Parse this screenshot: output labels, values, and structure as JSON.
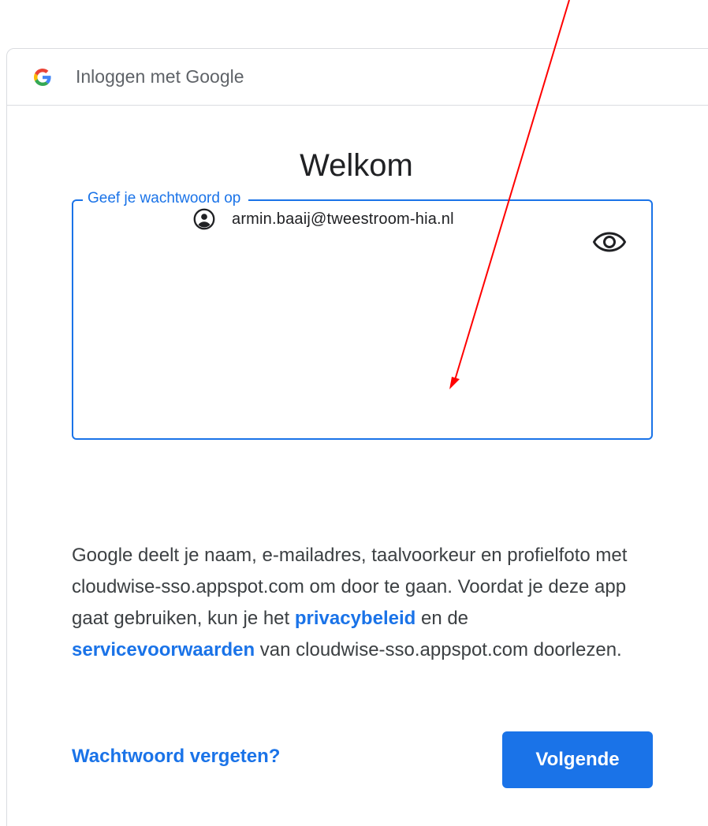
{
  "header": {
    "title": "Inloggen met Google",
    "logo_icon": "google-g-icon"
  },
  "main": {
    "title": "Welkom",
    "account": {
      "icon": "account-circle-icon",
      "email": "armin.baaij@tweestroom-hia.nl"
    },
    "password_field": {
      "label": "Geef je wachtwoord op",
      "value": "",
      "toggle_icon": "eye-icon"
    },
    "consent": {
      "part1": "Google deelt je naam, e-mailadres, taalvoorkeur en profielfoto met cloudwise-sso.appspot.com om door te gaan. Voordat je deze app gaat gebruiken, kun je het ",
      "privacy_link": "privacybeleid",
      "part2": " en de ",
      "terms_link": "servicevoorwaarden",
      "part3": " van cloudwise-sso.appspot.com doorlezen."
    },
    "forgot_link": "Wachtwoord vergeten?",
    "next_button": "Volgende"
  },
  "annotation": {
    "arrow_color": "#ff0000"
  },
  "colors": {
    "accent": "#1a73e8",
    "text_primary": "#202124",
    "text_secondary": "#3c4043",
    "border": "#dadce0"
  }
}
